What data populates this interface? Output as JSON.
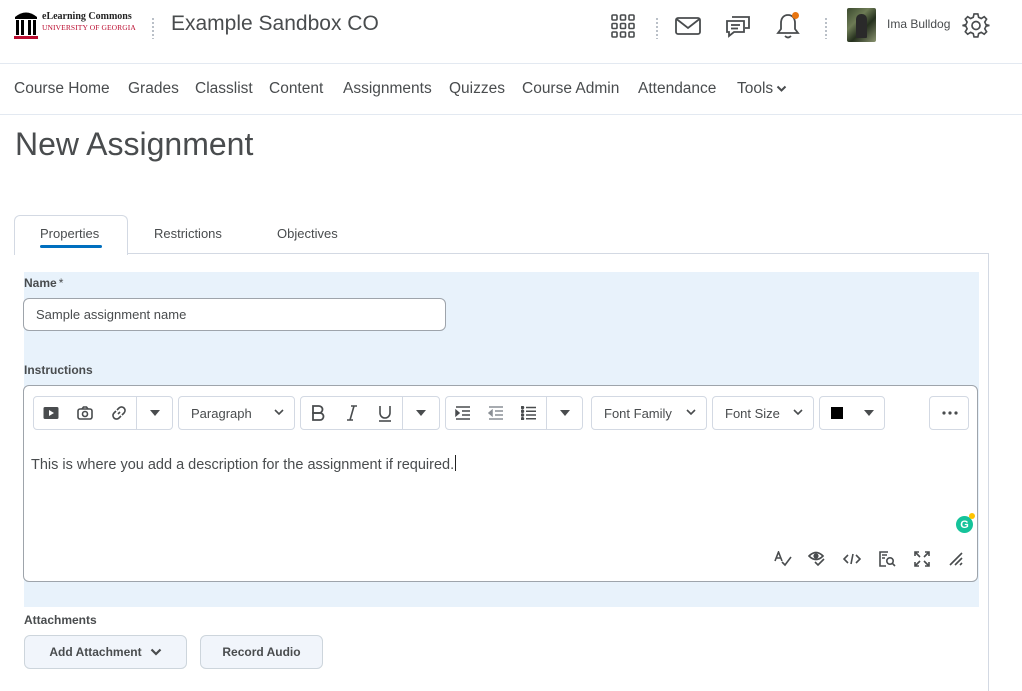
{
  "header": {
    "logo_line1": "eLearning Commons",
    "logo_line2": "UNIVERSITY OF GEORGIA",
    "org_title": "Example Sandbox CO",
    "user_name": "Ima Bulldog",
    "icons": [
      "waffle-icon",
      "mail-icon",
      "chat-icon",
      "bell-icon",
      "gear-icon"
    ],
    "notification_dot_color": "#e87511"
  },
  "nav": {
    "items": [
      "Course Home",
      "Grades",
      "Classlist",
      "Content",
      "Assignments",
      "Quizzes",
      "Course Admin",
      "Attendance",
      "Tools"
    ]
  },
  "page": {
    "title": "New Assignment"
  },
  "tabs": [
    "Properties",
    "Restrictions",
    "Objectives"
  ],
  "form": {
    "name_label": "Name",
    "name_required": "*",
    "name_value": "Sample assignment name",
    "instructions_label": "Instructions",
    "attachments_label": "Attachments"
  },
  "editor": {
    "paragraph_label": "Paragraph",
    "font_family_label": "Font Family",
    "font_size_label": "Font Size",
    "text_color": "#000000",
    "content": "This is where you add a description for the assignment if required."
  },
  "buttons": {
    "add_attachment": "Add Attachment",
    "record_audio": "Record Audio"
  },
  "colors": {
    "accent": "#006fbf",
    "highlight_background": "#e8f2fb",
    "brand_red": "#ba0c2f"
  }
}
